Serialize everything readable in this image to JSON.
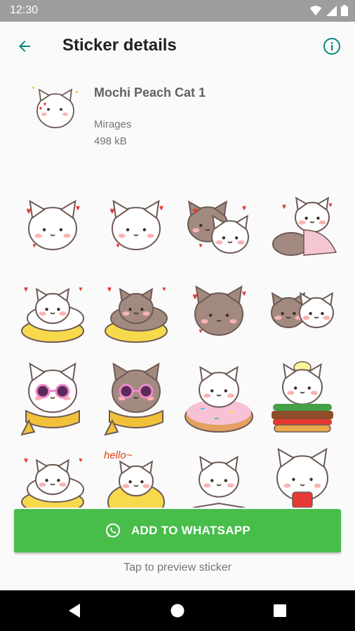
{
  "status_bar": {
    "time": "12:30",
    "icons": [
      "wifi-icon",
      "cellular-signal-icon",
      "battery-icon"
    ]
  },
  "app_bar": {
    "title": "Sticker details",
    "back_icon": "arrow-back-icon",
    "info_icon": "info-icon"
  },
  "pack": {
    "name": "Mochi Peach Cat 1",
    "publisher": "Mirages",
    "size": "498 kB"
  },
  "stickers": [
    {
      "id": 1,
      "kind": "white",
      "accessory": "hearts"
    },
    {
      "id": 2,
      "kind": "white",
      "accessory": "hearts"
    },
    {
      "id": 3,
      "kind": "brown-white",
      "accessory": "hearts"
    },
    {
      "id": 4,
      "kind": "brown-white",
      "accessory": "blanket"
    },
    {
      "id": 5,
      "kind": "white",
      "accessory": "pillow"
    },
    {
      "id": 6,
      "kind": "brown",
      "accessory": "pillow"
    },
    {
      "id": 7,
      "kind": "brown",
      "accessory": "hearts"
    },
    {
      "id": 8,
      "kind": "brown-white",
      "accessory": "hug"
    },
    {
      "id": 9,
      "kind": "white",
      "accessory": "sunglasses-scarf"
    },
    {
      "id": 10,
      "kind": "brown",
      "accessory": "sunglasses-scarf"
    },
    {
      "id": 11,
      "kind": "white",
      "accessory": "donut"
    },
    {
      "id": 12,
      "kind": "white",
      "accessory": "burger"
    },
    {
      "id": 13,
      "kind": "white",
      "accessory": "pillow"
    },
    {
      "id": 14,
      "kind": "white",
      "accessory": "hello-pillow",
      "text": "hello~"
    },
    {
      "id": 15,
      "kind": "white",
      "accessory": "book"
    },
    {
      "id": 16,
      "kind": "white",
      "accessory": "heart-box"
    }
  ],
  "actions": {
    "add_label": "ADD TO WHATSAPP",
    "add_icon": "whatsapp-icon",
    "hint": "Tap to preview sticker"
  },
  "nav": {
    "back": "nav-back-icon",
    "home": "nav-home-icon",
    "recents": "nav-recents-icon"
  },
  "colors": {
    "accent": "#00897b",
    "button": "#48bd4a",
    "status_bar": "#9e9e9e",
    "nav_bar": "#000000"
  }
}
